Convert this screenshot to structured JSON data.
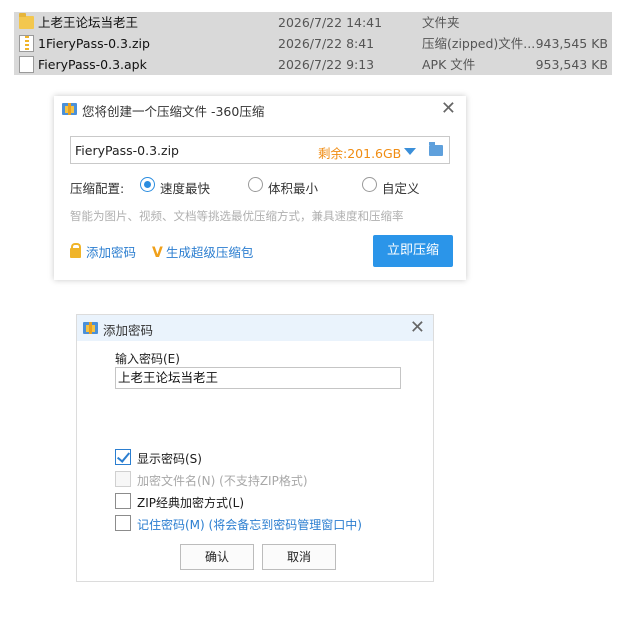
{
  "file_list": {
    "rows": [
      {
        "icon": "folder-icon",
        "name": "上老王论坛当老王",
        "date": "2026/7/22 14:41",
        "type": "文件夹",
        "size": ""
      },
      {
        "icon": "zip-file-icon",
        "name": "1FieryPass-0.3.zip",
        "date": "2026/7/22 8:41",
        "type": "压缩(zipped)文件...",
        "size": "943,545 KB"
      },
      {
        "icon": "file-icon",
        "name": "FieryPass-0.3.apk",
        "date": "2026/7/22 9:13",
        "type": "APK 文件",
        "size": "953,543 KB"
      }
    ]
  },
  "compress_dialog": {
    "title": "您将创建一个压缩文件 -360压缩",
    "close": "✕",
    "filename": "FieryPass-0.3.zip",
    "free_space": "剩余:201.6GB",
    "options_label": "压缩配置:",
    "options": [
      {
        "label": "速度最快",
        "selected": true
      },
      {
        "label": "体积最小",
        "selected": false
      },
      {
        "label": "自定义",
        "selected": false
      }
    ],
    "hint": "智能为图片、视频、文档等挑选最优压缩方式，兼具速度和压缩率",
    "add_password_link": "添加密码",
    "super_pack_link": "生成超级压缩包",
    "compress_button": "立即压缩"
  },
  "password_dialog": {
    "title": "添加密码",
    "close": "✕",
    "password_label": "输入密码(E)",
    "password_value": "上老王论坛当老王",
    "checkboxes": [
      {
        "label": "显示密码(S)",
        "checked": true,
        "disabled": false
      },
      {
        "label": "加密文件名(N) (不支持ZIP格式)",
        "checked": false,
        "disabled": true
      },
      {
        "label": "ZIP经典加密方式(L)",
        "checked": false,
        "disabled": false
      },
      {
        "label": "记住密码(M) (将会备忘到密码管理窗口中)",
        "checked": false,
        "disabled": false
      }
    ],
    "ok_button": "确认",
    "cancel_button": "取消"
  },
  "colors": {
    "accent_blue": "#2b95e9",
    "link_blue": "#2b7ed0",
    "free_space_orange": "#f08c12",
    "selection_gray": "#d9d9d9"
  }
}
